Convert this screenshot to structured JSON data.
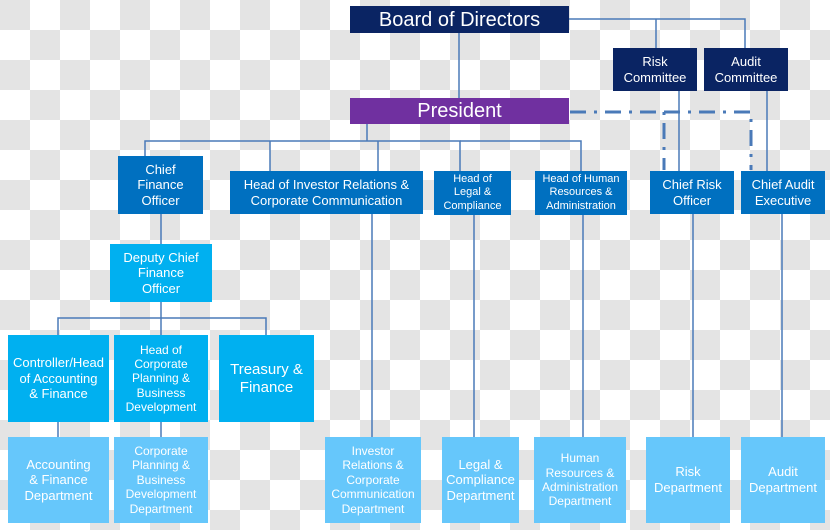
{
  "colors": {
    "board": "#0a2463",
    "president": "#7030a0",
    "executive": "#0070c0",
    "sub_executive": "#00b0f0",
    "department": "#66c7fb",
    "connector": "#4a7ab8"
  },
  "board": {
    "label": "Board of Directors"
  },
  "committees": [
    {
      "label": "Risk\nCommittee"
    },
    {
      "label": "Audit\nCommittee"
    }
  ],
  "president": {
    "label": "President"
  },
  "executives": [
    {
      "label": "Chief\nFinance\nOfficer"
    },
    {
      "label": "Head of Investor Relations &\nCorporate Communication"
    },
    {
      "label": "Head of\nLegal &\nCompliance"
    },
    {
      "label": "Head of Human\nResources &\nAdministration"
    },
    {
      "label": "Chief Risk\nOfficer"
    },
    {
      "label": "Chief Audit\nExecutive"
    }
  ],
  "deputy_cfo": {
    "label": "Deputy Chief\nFinance\nOfficer"
  },
  "finance_heads": [
    {
      "label": "Controller/Head\nof Accounting\n& Finance"
    },
    {
      "label": "Head of\nCorporate\nPlanning &\nBusiness\nDevelopment"
    },
    {
      "label": "Treasury &\nFinance"
    }
  ],
  "departments": [
    {
      "label": "Accounting\n& Finance\nDepartment"
    },
    {
      "label": "Corporate\nPlanning &\nBusiness\nDevelopment\nDepartment"
    },
    {
      "label": "Investor\nRelations &\nCorporate\nCommunication\nDepartment"
    },
    {
      "label": "Legal &\nCompliance\nDepartment"
    },
    {
      "label": "Human\nResources &\nAdministration\nDepartment"
    },
    {
      "label": "Risk\nDepartment"
    },
    {
      "label": "Audit\nDepartment"
    }
  ]
}
